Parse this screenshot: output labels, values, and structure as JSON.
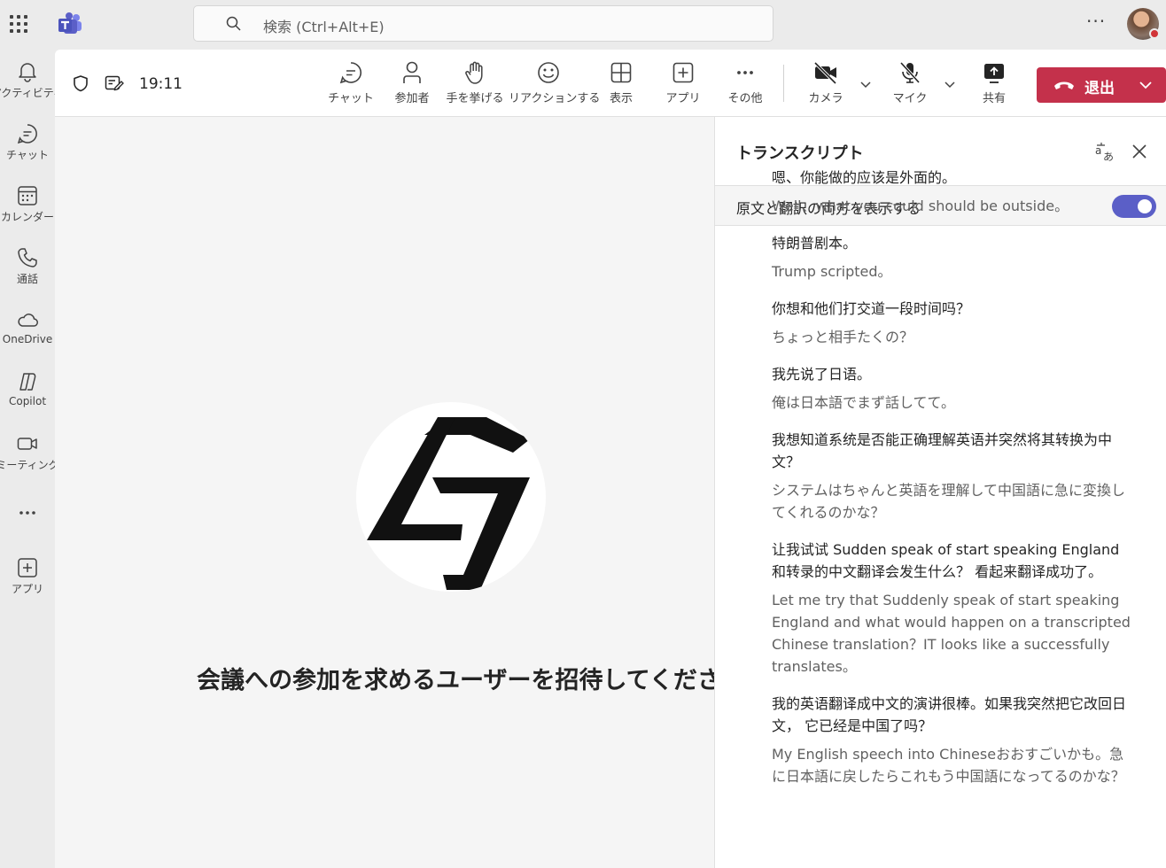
{
  "search": {
    "placeholder": "検索 (Ctrl+Alt+E)"
  },
  "rail": {
    "items": [
      {
        "label": "アクティビティ",
        "icon": "bell-icon"
      },
      {
        "label": "チャット",
        "icon": "chat-icon"
      },
      {
        "label": "カレンダー",
        "icon": "calendar-icon"
      },
      {
        "label": "通話",
        "icon": "phone-icon"
      },
      {
        "label": "OneDrive",
        "icon": "cloud-icon"
      },
      {
        "label": "Copilot",
        "icon": "copilot-icon"
      },
      {
        "label": "ミーティング",
        "icon": "video-icon"
      },
      {
        "label": "",
        "icon": "more-icon"
      },
      {
        "label": "アプリ",
        "icon": "add-app-icon"
      }
    ]
  },
  "toolbar": {
    "time": "19:11",
    "chat": "チャット",
    "people": "参加者",
    "raise_hand": "手を挙げる",
    "react": "リアクションする",
    "view": "表示",
    "apps": "アプリ",
    "more": "その他",
    "camera": "カメラ",
    "mic": "マイク",
    "share": "共有",
    "leave": "退出"
  },
  "stage": {
    "invite_text": "会議への参加を求めるユーザーを招待してください"
  },
  "transcript": {
    "title": "トランスクリプト",
    "toggle_label": "原文と翻訳の両方を表示する",
    "toggle_on": true,
    "entries": [
      {
        "original": "嗯、你能做的应该是外面的。",
        "translation": "Well、what you could should be outside。"
      },
      {
        "original": "特朗普剧本。",
        "translation": "Trump scripted。"
      },
      {
        "original": "你想和他们打交道一段时间吗？",
        "translation": "ちょっと相手たくの？"
      },
      {
        "original": "我先说了日语。",
        "translation": "俺は日本語でまず話してて。"
      },
      {
        "original": "我想知道系统是否能正确理解英语并突然将其转换为中文？",
        "translation": "システムはちゃんと英語を理解して中国語に急に変換してくれるのかな？"
      },
      {
        "original": "让我试试 Sudden speak of start speaking England 和转录的中文翻译会发生什么？ 看起来翻译成功了。",
        "translation": "Let me try that Suddenly speak of start speaking England and what would happen on a transcripted Chinese translation？IT looks like a successfully translates。"
      },
      {
        "original": "我的英语翻译成中文的演讲很棒。如果我突然把它改回日文， 它已经是中国了吗？",
        "translation": "My English speech into Chineseおおすごいかも。急に日本語に戻したらこれもう中国語になってるのかな？"
      }
    ]
  },
  "colors": {
    "leave": "#c4314b",
    "toggle": "#5b5fc7",
    "teams_brand": "#5b5fc7"
  }
}
